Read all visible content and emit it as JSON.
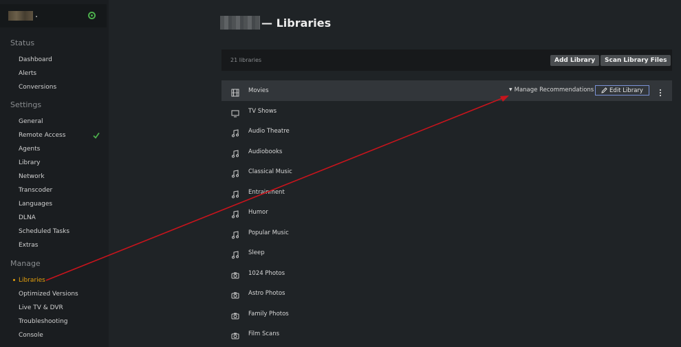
{
  "sidebar": {
    "sections": [
      {
        "title": "Status",
        "items": [
          "Dashboard",
          "Alerts",
          "Conversions"
        ]
      },
      {
        "title": "Settings",
        "items": [
          "General",
          "Remote Access",
          "Agents",
          "Library",
          "Network",
          "Transcoder",
          "Languages",
          "DLNA",
          "Scheduled Tasks",
          "Extras"
        ]
      },
      {
        "title": "Manage",
        "items": [
          "Libraries",
          "Optimized Versions",
          "Live TV & DVR",
          "Troubleshooting",
          "Console"
        ]
      }
    ],
    "active_item": "Libraries",
    "icons": {
      "server_status": "server-online-icon",
      "remote_access": "checkmark-icon"
    }
  },
  "header": {
    "title": "— Libraries"
  },
  "toolbar": {
    "count": "21 libraries",
    "add_label": "Add Library",
    "scan_label": "Scan Library Files"
  },
  "libraries": [
    {
      "label": "Movies",
      "icon": "film-icon"
    },
    {
      "label": "TV Shows",
      "icon": "tv-icon"
    },
    {
      "label": "Audio Theatre",
      "icon": "music-icon"
    },
    {
      "label": "Audiobooks",
      "icon": "music-icon"
    },
    {
      "label": "Classical Music",
      "icon": "music-icon"
    },
    {
      "label": "Entrainment",
      "icon": "music-icon"
    },
    {
      "label": "Humor",
      "icon": "music-icon"
    },
    {
      "label": "Popular Music",
      "icon": "music-icon"
    },
    {
      "label": "Sleep",
      "icon": "music-icon"
    },
    {
      "label": "1024 Photos",
      "icon": "camera-icon"
    },
    {
      "label": "Astro Photos",
      "icon": "camera-icon"
    },
    {
      "label": "Family Photos",
      "icon": "camera-icon"
    },
    {
      "label": "Film Scans",
      "icon": "camera-icon"
    }
  ],
  "row_actions": {
    "manage_recs_label": "Manage Recommendations",
    "edit_label": "Edit Library"
  },
  "colors": {
    "accent": "#e5a00d",
    "online": "#4cae4c",
    "annotation_arrow": "#c8141c",
    "edit_border": "#7b93d8"
  }
}
